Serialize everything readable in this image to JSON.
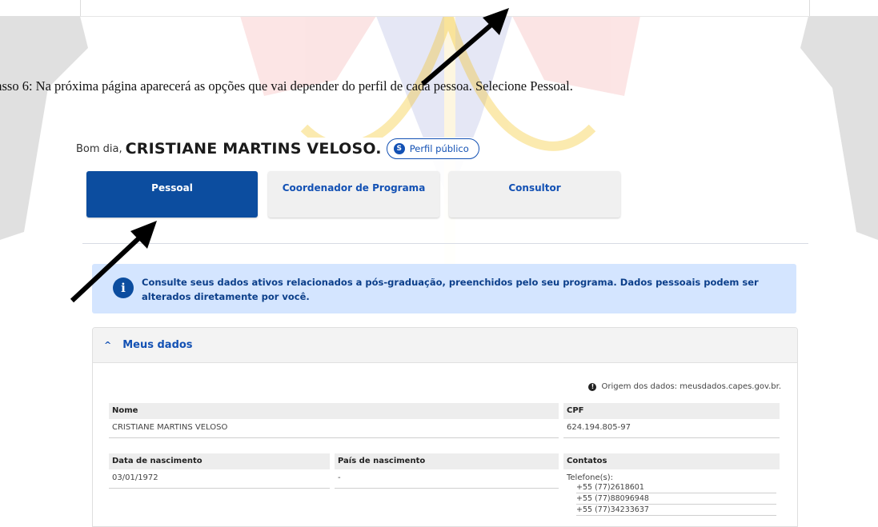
{
  "instruction": "Passo 6: Na próxima página aparecerá as opções que vai depender do perfil de cada pessoa. Selecione Pessoal.",
  "header": {
    "greeting_prefix": "Bom dia,",
    "user_name": "CRISTIANE MARTINS VELOSO.",
    "public_profile_icon": "S",
    "public_profile_label": "Perfil público"
  },
  "tabs": [
    {
      "label": "Pessoal",
      "active": true
    },
    {
      "label": "Coordenador de Programa",
      "active": false
    },
    {
      "label": "Consultor",
      "active": false
    }
  ],
  "alert": {
    "icon": "i",
    "text": "Consulte seus dados ativos relacionados a pós-graduação, preenchidos pelo seu programa. Dados pessoais podem ser alterados diretamente por você."
  },
  "section": {
    "title": "Meus dados",
    "source_icon": "!",
    "source_text": "Origem dos dados: meusdados.capes.gov.br.",
    "fields": {
      "nome": {
        "label": "Nome",
        "value": "CRISTIANE MARTINS VELOSO"
      },
      "cpf": {
        "label": "CPF",
        "value": "624.194.805-97"
      },
      "nascimento": {
        "label": "Data de nascimento",
        "value": "03/01/1972"
      },
      "pais": {
        "label": "País de nascimento",
        "value": "-"
      },
      "contatos": {
        "label": "Contatos",
        "phones_label": "Telefone(s):",
        "phones": [
          "+55 (77)2618601",
          "+55 (77)88096948",
          "+55 (77)34233637"
        ]
      }
    }
  },
  "colors": {
    "primary": "#0c4d9f",
    "link": "#1351b4",
    "alert_bg": "#d4e5ff",
    "watermark_blue": "#3f51b5",
    "watermark_red": "#e53935",
    "watermark_yellow": "#f4c21a"
  }
}
